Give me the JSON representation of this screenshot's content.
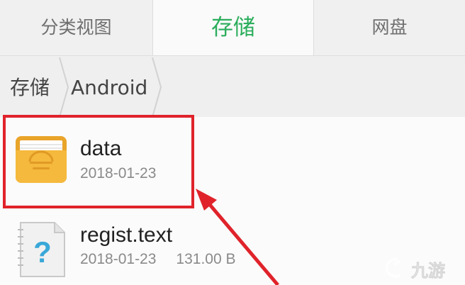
{
  "tabs": [
    {
      "label": "分类视图",
      "active": false
    },
    {
      "label": "存储",
      "active": true
    },
    {
      "label": "网盘",
      "active": false
    }
  ],
  "breadcrumb": [
    "存储",
    "Android"
  ],
  "files": [
    {
      "name": "data",
      "date": "2018-01-23",
      "size": "",
      "icon": "folder-icon"
    },
    {
      "name": "regist.text",
      "date": "2018-01-23",
      "size": "131.00 B",
      "icon": "unknown-file-icon"
    }
  ],
  "colors": {
    "accent": "#2bad5c",
    "annotation": "#e0232b",
    "folder": "#f2b43c"
  },
  "annotation": {
    "type": "red-box-with-arrow",
    "target": "data"
  },
  "watermark": {
    "text": "九游",
    "logo": "jiuyou-logo"
  }
}
